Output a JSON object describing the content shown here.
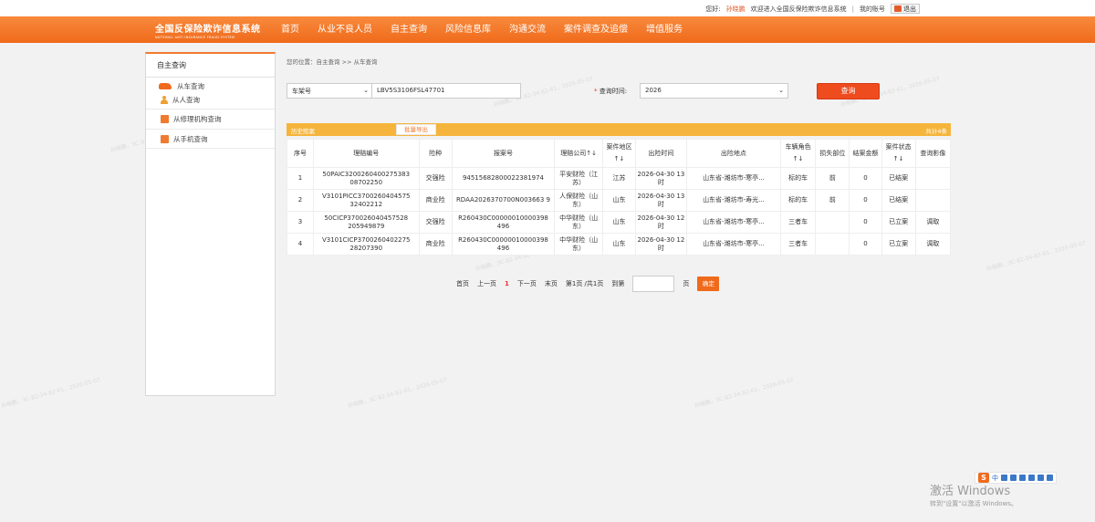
{
  "topbar": {
    "greeting": "您好:",
    "user": "孙晓鹏",
    "welcome": "欢迎进入全国反保险欺诈信息系统",
    "separator": "|",
    "my_account": "我的账号",
    "logout": "退出"
  },
  "header": {
    "logo_cn": "全国反保险欺诈信息系统",
    "logo_en": "NATIONAL ANTI INSURANCE FRAUD SYSTEM",
    "nav": [
      "首页",
      "从业不良人员",
      "自主查询",
      "风险信息库",
      "沟通交流",
      "案件调查及追偿",
      "增值服务"
    ]
  },
  "sidebar": {
    "title": "自主查询",
    "items": [
      {
        "label": "从车查询",
        "icon": "car-icon"
      },
      {
        "label": "从人查询",
        "icon": "person-icon"
      },
      {
        "label": "从修理机构查询",
        "icon": "repair-icon"
      },
      {
        "label": "从手机查询",
        "icon": "phone-icon"
      }
    ]
  },
  "breadcrumb": "您的位置：自主查询 >> 从车查询",
  "search": {
    "field_type": "车架号",
    "field_value": "LBV5S3106FSL47701",
    "required_mark": "*",
    "time_label": "查询时间:",
    "time_value": "2026",
    "query_button": "查询"
  },
  "toolbar": {
    "history_label": "历史赔案",
    "export_button": "批量导出",
    "total_label": "共计4条"
  },
  "table": {
    "columns": [
      "序号",
      "理赔编号",
      "险种",
      "报案号",
      "理赔公司↑↓",
      "案件地区↑↓",
      "出险时间",
      "出险地点",
      "车辆角色↑↓",
      "损失部位",
      "结案金额",
      "案件状态↑↓",
      "查询影像"
    ],
    "rows": [
      [
        "1",
        "50PAIC3200260400275383 08702250",
        "交强险",
        "94515682800022381974",
        "平安财险（江苏）",
        "江苏",
        "2026-04-30 13时",
        "山东省-潍坊市-寒亭...",
        "标的车",
        "前",
        "0",
        "已结案",
        ""
      ],
      [
        "2",
        "V3101PICC3700260404575 32402212",
        "商业险",
        "RDAA2026370700N003663 9",
        "人保财险（山东）",
        "山东",
        "2026-04-30 13时",
        "山东省-潍坊市-寿光...",
        "标的车",
        "前",
        "0",
        "已结案",
        ""
      ],
      [
        "3",
        "50CICP370026040457528 205949879",
        "交强险",
        "R260430C00000010000398 496",
        "中华财险（山东）",
        "山东",
        "2026-04-30 12时",
        "山东省-潍坊市-寒亭...",
        "三者车",
        "",
        "0",
        "已立案",
        "调取"
      ],
      [
        "4",
        "V3101CICP3700260402275 28207390",
        "商业险",
        "R260430C00000010000398 496",
        "中华财险（山东）",
        "山东",
        "2026-04-30 12时",
        "山东省-潍坊市-寒亭...",
        "三者车",
        "",
        "0",
        "已立案",
        "调取"
      ]
    ]
  },
  "pager": {
    "first": "首页",
    "prev": "上一页",
    "current": "1",
    "next": "下一页",
    "last": "末页",
    "info": "第1页 /共1页",
    "goto_label": "到第",
    "page_label": "页",
    "ok": "确定"
  },
  "windows": {
    "line1": "激活 Windows",
    "line2": "转到\"设置\"以激活 Windows。"
  },
  "ime": {
    "logo": "S",
    "lang": "中"
  },
  "watermark": "孙晓鹏，3C-82-34-82-61，2026-05-07",
  "colors": {
    "brand": "#f06a1b",
    "toolbar": "#f5b53c",
    "query_button": "#ee4b1f"
  }
}
